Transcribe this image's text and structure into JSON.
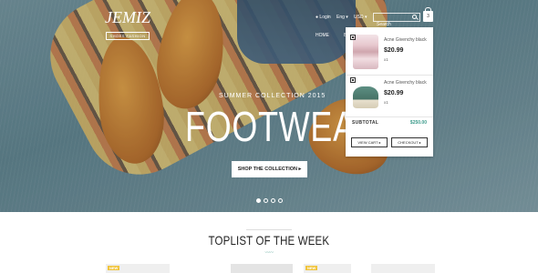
{
  "logo": {
    "title": "JEMIZ",
    "tagline": "SHOES FASHION"
  },
  "topbar": {
    "login": "Login",
    "language": "Eng ▾",
    "currency": "USD ▾",
    "search_placeholder": "Search",
    "cart_count": "3"
  },
  "nav": {
    "items": [
      "HOME",
      "BR"
    ]
  },
  "hero": {
    "subtitle": "SUMMER COLLECTION 2015",
    "title": "FOOTWEAR",
    "button_label": "SHOP THE COLLECTION ▸",
    "slides": 4,
    "active_slide": 1
  },
  "cart": {
    "items": [
      {
        "name": "Acne Givenchy black",
        "price": "$20.99",
        "qty": "x1",
        "icon": "sweater"
      },
      {
        "name": "Acne Givenchy black",
        "price": "$20.99",
        "qty": "x1",
        "icon": "boat-shoe"
      }
    ],
    "subtotal_label": "SUBTOTAL",
    "subtotal_value": "$250.00",
    "view_cart": "VIEW CART ▸",
    "checkout": "CHECKOUT ▸"
  },
  "section": {
    "title": "TOPLIST OF THE WEEK"
  },
  "products": {
    "badges": [
      "NEW",
      "NEW"
    ]
  },
  "colors": {
    "accent": "#3a9a8a",
    "badge": "#f0c43c"
  }
}
